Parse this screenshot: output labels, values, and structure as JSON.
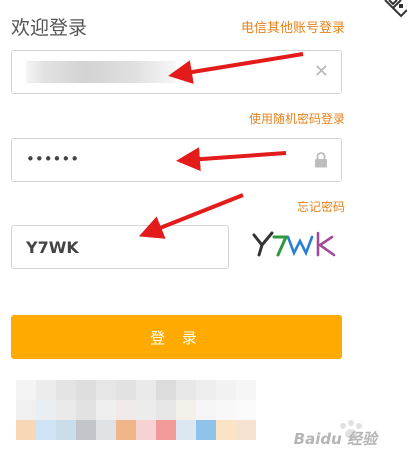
{
  "header": {
    "title": "欢迎登录",
    "other_account_link": "电信其他账号登录"
  },
  "phone_field": {
    "value": ""
  },
  "password_field": {
    "value": "••••••",
    "random_code_link": "使用随机密码登录"
  },
  "captcha_field": {
    "value": "Y7WK",
    "forgot_link": "忘记密码"
  },
  "login_button": {
    "label": "登 录"
  },
  "watermark": {
    "text": "Baidu 经验"
  },
  "colors": {
    "accent": "#ffaa00",
    "link": "#e8821a",
    "annotation": "#e31b1b"
  }
}
